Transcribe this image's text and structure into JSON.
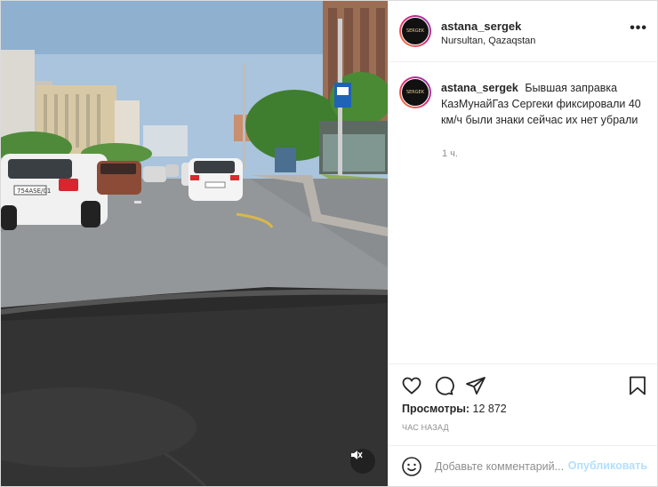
{
  "post": {
    "username": "astana_sergek",
    "location": "Nursultan, Qazaqstan",
    "more_label": "•••",
    "avatar_text": "SERGEK",
    "caption_user": "astana_sergek",
    "caption_text": "Бывшая заправка КазМунайГаз Сергеки фиксировали 40 км/ч были знаки сейчас их нет убрали",
    "caption_time": "1 ч.",
    "views_label": "Просмотры:",
    "views_count": "12 872",
    "time_ago": "ЧАС НАЗАД",
    "comment_placeholder": "Добавьте комментарий...",
    "publish_label": "Опубликовать"
  },
  "media": {
    "car_plate": "754ASE/01",
    "bus_stop_sign": "bus-stop-icon"
  },
  "icons": {
    "like": "heart-icon",
    "comment": "comment-icon",
    "share": "share-icon",
    "save": "bookmark-icon",
    "emoji": "emoji-icon",
    "mute": "muted-speaker-icon"
  },
  "colors": {
    "publish_disabled": "#b2dffc",
    "muted_text": "#8e8e8e",
    "border": "#dbdbdb"
  }
}
